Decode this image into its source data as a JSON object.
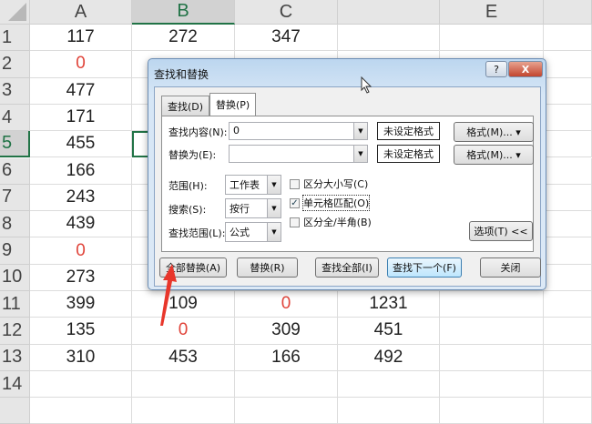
{
  "columns": [
    "A",
    "B",
    "C",
    "",
    "E",
    ""
  ],
  "selected_column": 1,
  "selected_row": 5,
  "rows": [
    {
      "n": "1",
      "cells": [
        "117",
        "272",
        "347",
        "",
        "",
        ""
      ]
    },
    {
      "n": "2",
      "cells": [
        "0",
        "",
        "",
        "",
        "",
        ""
      ]
    },
    {
      "n": "3",
      "cells": [
        "477",
        "",
        "",
        "",
        "",
        ""
      ]
    },
    {
      "n": "4",
      "cells": [
        "171",
        "",
        "",
        "",
        "",
        ""
      ]
    },
    {
      "n": "5",
      "cells": [
        "455",
        "",
        "",
        "",
        "",
        ""
      ]
    },
    {
      "n": "6",
      "cells": [
        "166",
        "",
        "",
        "",
        "",
        ""
      ]
    },
    {
      "n": "7",
      "cells": [
        "243",
        "",
        "",
        "",
        "",
        ""
      ]
    },
    {
      "n": "8",
      "cells": [
        "439",
        "",
        "",
        "",
        "",
        ""
      ]
    },
    {
      "n": "9",
      "cells": [
        "0",
        "",
        "",
        "",
        "",
        ""
      ]
    },
    {
      "n": "10",
      "cells": [
        "273",
        "",
        "",
        "",
        "",
        ""
      ]
    },
    {
      "n": "11",
      "cells": [
        "399",
        "109",
        "0",
        "1231",
        "",
        ""
      ]
    },
    {
      "n": "12",
      "cells": [
        "135",
        "0",
        "309",
        "451",
        "",
        ""
      ]
    },
    {
      "n": "13",
      "cells": [
        "310",
        "453",
        "166",
        "492",
        "",
        ""
      ]
    },
    {
      "n": "14",
      "cells": [
        "",
        "",
        "",
        "",
        "",
        ""
      ]
    },
    {
      "n": "",
      "cells": [
        "",
        "",
        "",
        "",
        "",
        ""
      ]
    }
  ],
  "zero_color": "#e0443a",
  "dialog": {
    "title": "查找和替换",
    "help": "?",
    "close": "X",
    "tab_find": "查找(D)",
    "tab_replace": "替换(P)",
    "find_label": "查找内容(N):",
    "find_value": "0",
    "replace_label": "替换为(E):",
    "replace_value": "",
    "no_format": "未设定格式",
    "format_btn": "格式(M)...",
    "scope_label": "范围(H):",
    "scope_value": "工作表",
    "search_label": "搜索(S):",
    "search_value": "按行",
    "lookin_label": "查找范围(L):",
    "lookin_value": "公式",
    "match_case": "区分大小写(C)",
    "match_case_checked": false,
    "match_cell": "单元格匹配(O)",
    "match_cell_checked": true,
    "match_width": "区分全/半角(B)",
    "match_width_checked": false,
    "options_btn": "选项(T) <<",
    "replace_all": "全部替换(A)",
    "replace": "替换(R)",
    "find_all": "查找全部(I)",
    "find_next": "查找下一个(F)",
    "close_btn": "关闭"
  }
}
